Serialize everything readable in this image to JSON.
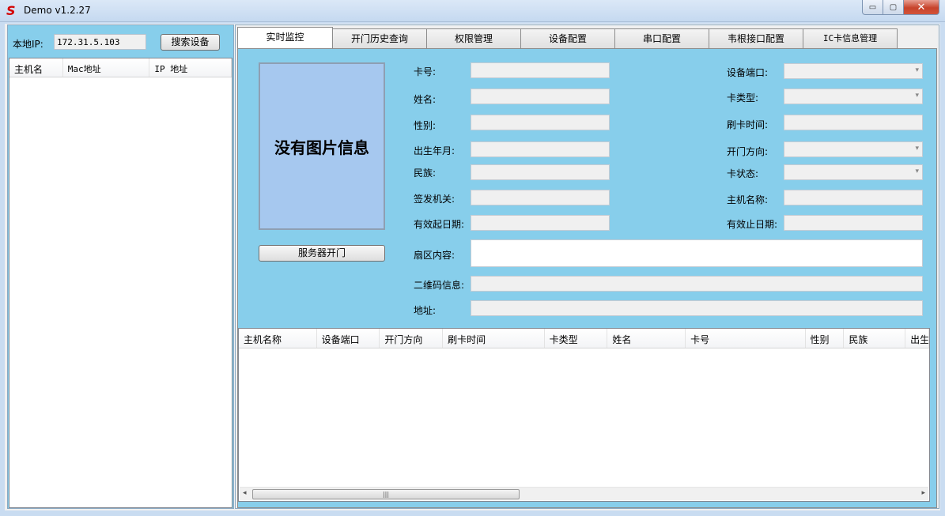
{
  "window": {
    "title": "Demo  v1.2.27",
    "icon": "app-s-logo-icon",
    "controls": {
      "minimize": "▭",
      "maximize": "▢",
      "close": "✕"
    }
  },
  "left_panel": {
    "local_ip_label": "本地IP:",
    "local_ip_value": "172.31.5.103",
    "search_button": "搜索设备",
    "columns": [
      "主机名",
      "Mac地址",
      "IP 地址"
    ]
  },
  "tabs": [
    "实时监控",
    "开门历史查询",
    "权限管理",
    "设备配置",
    "串口配置",
    "韦根接口配置",
    "IC卡信息管理"
  ],
  "active_tab": 0,
  "monitor": {
    "photo_placeholder": "没有图片信息",
    "open_button": "服务器开门",
    "fields_left": {
      "card_no": "卡号:",
      "name": "姓名:",
      "gender": "性别:",
      "birth": "出生年月:",
      "ethnicity": "民族:",
      "issuer": "签发机关:",
      "valid_from": "有效起日期:",
      "sector": "扇区内容:",
      "qrcode": "二维码信息:",
      "address": "地址:"
    },
    "fields_right": {
      "port": "设备端口:",
      "card_type": "卡类型:",
      "swipe_time": "刷卡时间:",
      "door_dir": "开门方向:",
      "card_state": "卡状态:",
      "host_name": "主机名称:",
      "valid_to": "有效止日期:"
    }
  },
  "records": {
    "columns": [
      "主机名称",
      "设备端口",
      "开门方向",
      "刷卡时间",
      "卡类型",
      "姓名",
      "卡号",
      "性别",
      "民族",
      "出生"
    ]
  },
  "colors": {
    "panel_bg": "#87ceeb",
    "photo_bg": "#a6c8ef"
  }
}
